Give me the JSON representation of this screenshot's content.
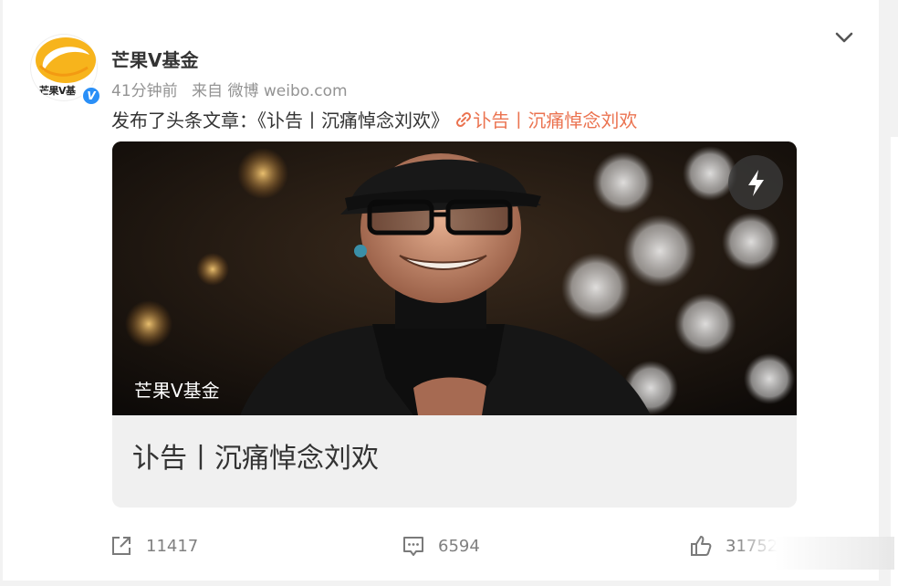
{
  "post": {
    "author": "芒果V基金",
    "time": "41分钟前",
    "source": "来自 微博 weibo.com",
    "text": "发布了头条文章：《讣告丨沉痛悼念刘欢》",
    "link_text": "讣告丨沉痛悼念刘欢",
    "avatar_text": "芒果V基"
  },
  "article": {
    "cover_caption": "芒果V基金",
    "title": "讣告丨沉痛悼念刘欢"
  },
  "actions": {
    "repost_count": "11417",
    "comment_count": "6594",
    "like_count": "31752"
  },
  "colors": {
    "link": "#eb7350",
    "verified": "#2a8ff7",
    "muted": "#939393"
  },
  "icons": [
    "chevron-down-icon",
    "link-icon",
    "flash-icon",
    "share-icon",
    "comment-icon",
    "like-icon",
    "verified-icon"
  ]
}
